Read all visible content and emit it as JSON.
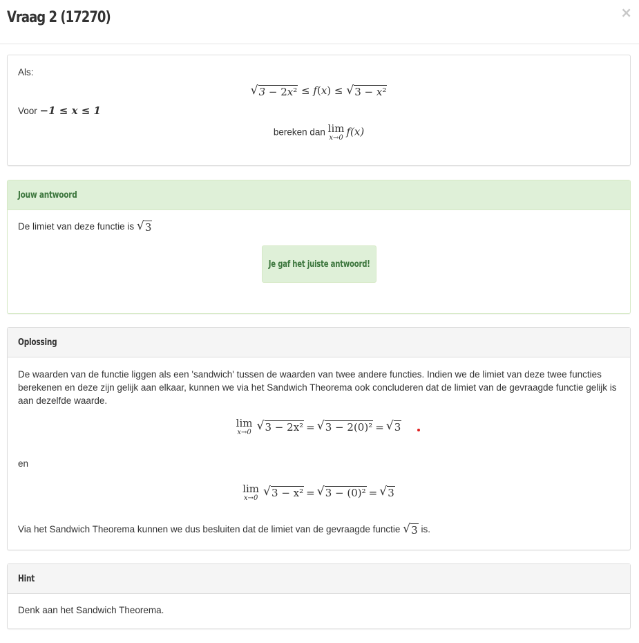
{
  "modal": {
    "title": "Vraag 2 (17270)",
    "close_symbol": "×"
  },
  "question": {
    "intro": "Als:",
    "inequality": "√(3 − 2x²) ≤ f(x) ≤ √(3 − x²)",
    "domain_prefix": "Voor",
    "domain": "−1 ≤ x ≤ 1",
    "compute_prefix": "bereken dan",
    "limit_op": "lim",
    "limit_sub": "x→0",
    "limit_expr": "f(x)"
  },
  "answer": {
    "heading": "Jouw antwoord",
    "text": "De limiet van deze functie is",
    "value": "3",
    "feedback": "Je gaf het juiste antwoord!",
    "feedback_color": "#3c763d"
  },
  "solution": {
    "heading": "Oplossing",
    "paragraph": "De waarden van de functie liggen als een 'sandwich' tussen de waarden van twee andere functies. Indien we de limiet van deze twee functies berekenen en deze zijn gelijk aan elkaar, kunnen we via het Sandwich Theorema ook concluderen dat de limiet van de gevraagde functie gelijk is aan dezelfde waarde.",
    "lim1": {
      "op": "lim",
      "sub": "x→0",
      "f": "3 − 2x²",
      "sub_in": "3 − 2(0)²",
      "result": "3"
    },
    "connector": "en",
    "lim2": {
      "op": "lim",
      "sub": "x→0",
      "f": "3 − x²",
      "sub_in": "3 − (0)²",
      "result": "3"
    },
    "conclusion_pre": "Via het Sandwich Theorema kunnen we dus besluiten dat de limiet van de gevraagde functie",
    "conclusion_value": "3",
    "conclusion_post": "is."
  },
  "hint": {
    "heading": "Hint",
    "text": "Denk aan het Sandwich Theorema."
  },
  "colors": {
    "success_bg": "#dff0d8",
    "success_border": "#d6e9c6",
    "heading_bg": "#f5f5f5"
  }
}
